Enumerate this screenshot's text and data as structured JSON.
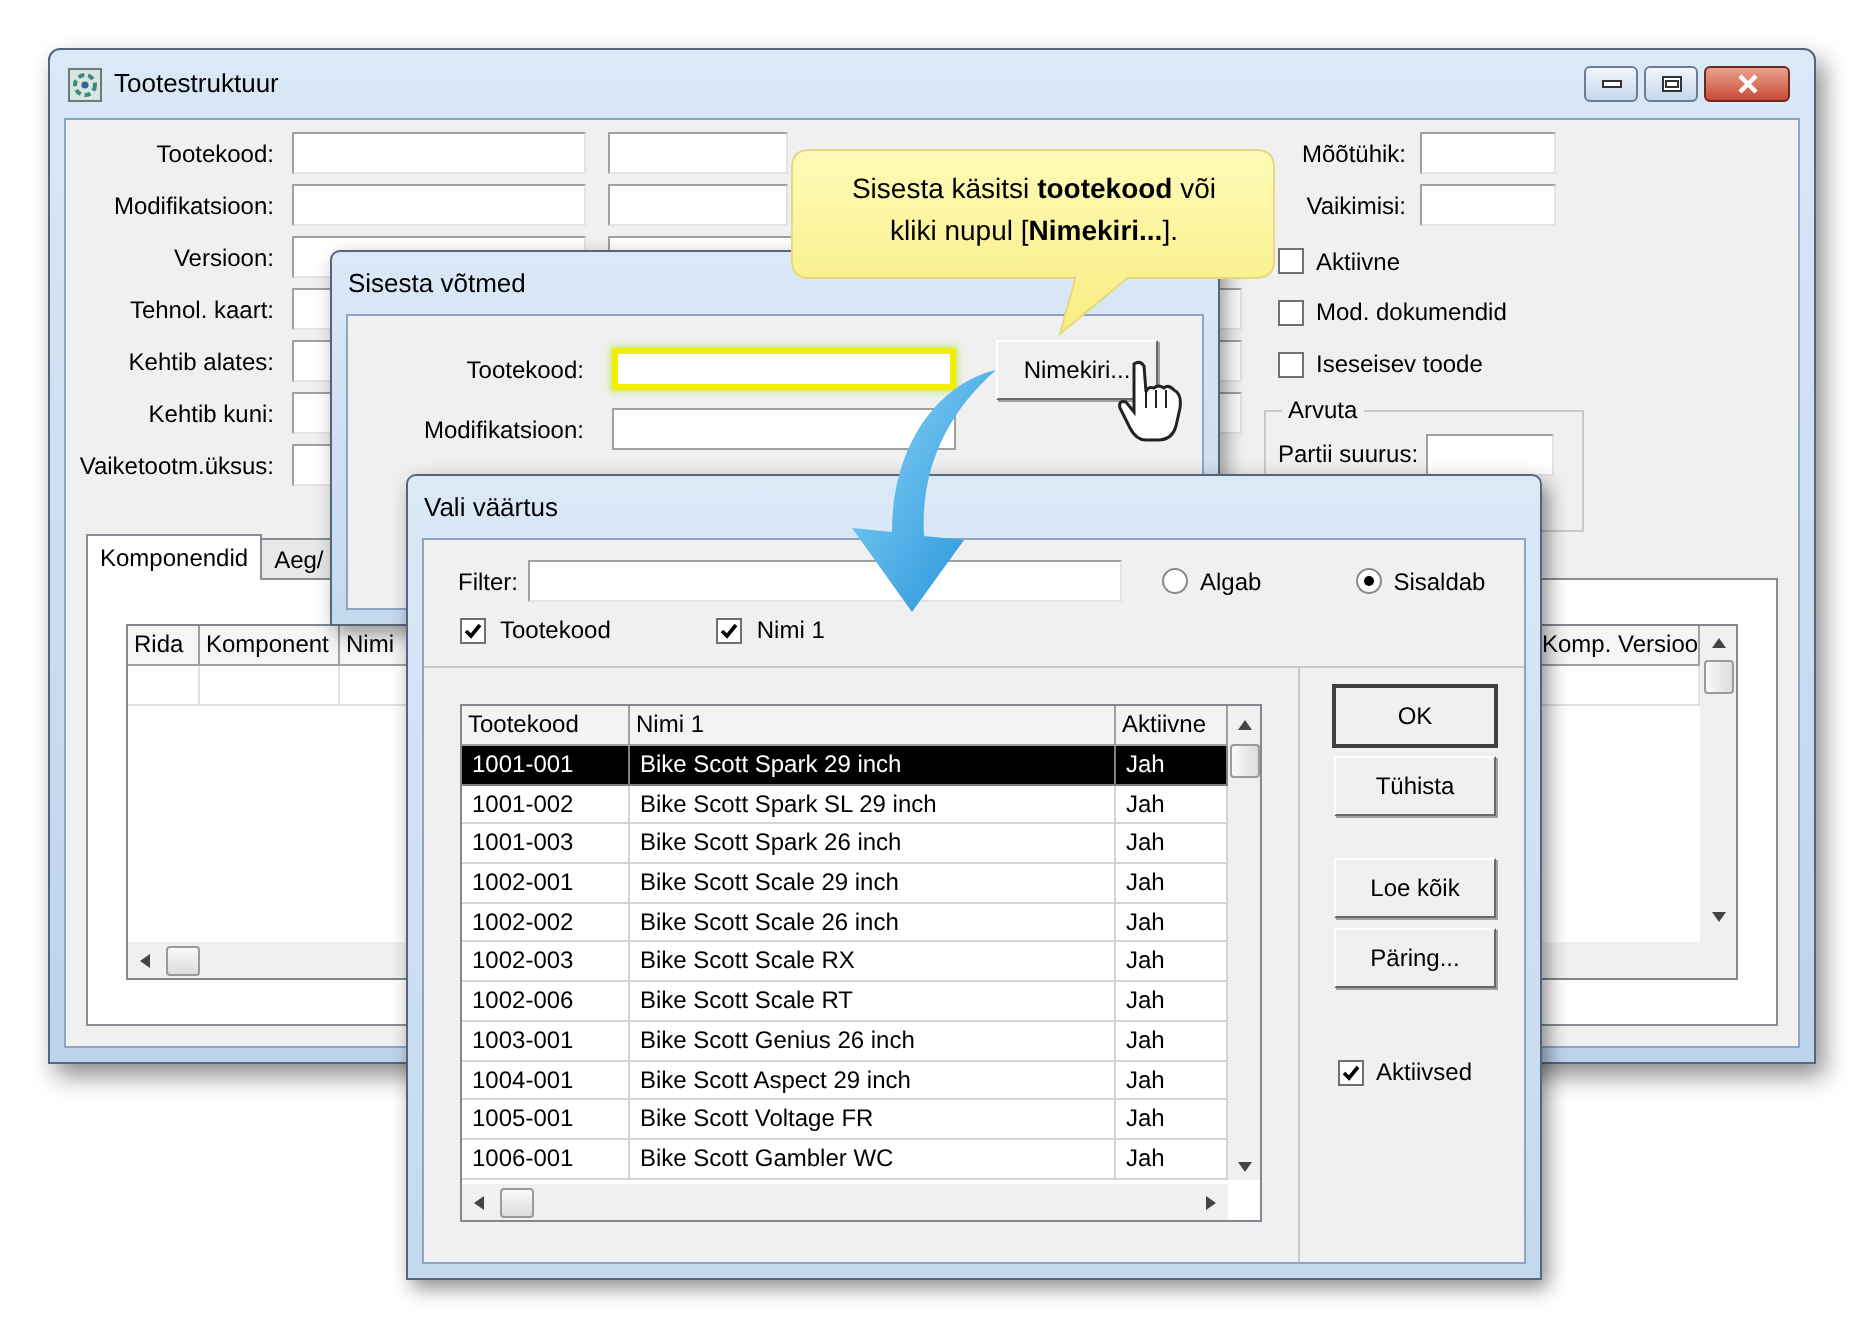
{
  "main_window": {
    "title": "Tootestruktuur",
    "fields": [
      "Tootekood:",
      "Modifikatsioon:",
      "Versioon:",
      "Tehnol. kaart:",
      "Kehtib alates:",
      "Kehtib kuni:",
      "Vaiketootm.üksus:"
    ],
    "side_fields": [
      "Mõõtühik:",
      "Vaikimisi:"
    ],
    "checkboxes": [
      {
        "label": "Aktiivne",
        "checked": false
      },
      {
        "label": "Mod. dokumendid",
        "checked": false
      },
      {
        "label": "Iseseisev toode",
        "checked": false
      }
    ],
    "group": {
      "title": "Arvuta",
      "field_label": "Partii suurus:"
    },
    "tabs": [
      {
        "label": "Komponendid",
        "selected": true
      },
      {
        "label": "Aeg/",
        "selected": false
      }
    ],
    "grid": {
      "columns": [
        "Rida",
        "Komponent",
        "Nimi",
        "Komp. Versioo"
      ]
    }
  },
  "keys_dialog": {
    "title": "Sisesta võtmed",
    "fields": [
      {
        "label": "Tootekood:",
        "focused": true
      },
      {
        "label": "Modifikatsioon:",
        "focused": false
      }
    ],
    "button": "Nimekiri..."
  },
  "callout": {
    "text": "Sisesta käsitsi **tootekood** või kliki nupul [**Nimekiri...**]."
  },
  "select_dialog": {
    "title": "Vali väärtus",
    "filter_label": "Filter:",
    "radios": [
      {
        "label": "Algab",
        "selected": false
      },
      {
        "label": "Sisaldab",
        "selected": true
      }
    ],
    "checkboxes": [
      {
        "label": "Tootekood",
        "checked": true
      },
      {
        "label": "Nimi 1",
        "checked": true
      }
    ],
    "table": {
      "columns": [
        "Tootekood",
        "Nimi 1",
        "Aktiivne"
      ],
      "rows": [
        {
          "cells": [
            "1001-001",
            "Bike Scott Spark 29 inch",
            "Jah"
          ],
          "selected": true
        },
        {
          "cells": [
            "1001-002",
            "Bike Scott Spark SL 29 inch",
            "Jah"
          ],
          "selected": false
        },
        {
          "cells": [
            "1001-003",
            "Bike Scott Spark 26 inch",
            "Jah"
          ],
          "selected": false
        },
        {
          "cells": [
            "1002-001",
            "Bike Scott Scale 29 inch",
            "Jah"
          ],
          "selected": false
        },
        {
          "cells": [
            "1002-002",
            "Bike Scott Scale 26 inch",
            "Jah"
          ],
          "selected": false
        },
        {
          "cells": [
            "1002-003",
            "Bike Scott Scale RX",
            "Jah"
          ],
          "selected": false
        },
        {
          "cells": [
            "1002-006",
            "Bike Scott Scale RT",
            "Jah"
          ],
          "selected": false
        },
        {
          "cells": [
            "1003-001",
            "Bike Scott Genius 26 inch",
            "Jah"
          ],
          "selected": false
        },
        {
          "cells": [
            "1004-001",
            "Bike Scott Aspect 29 inch",
            "Jah"
          ],
          "selected": false
        },
        {
          "cells": [
            "1005-001",
            "Bike Scott Voltage FR",
            "Jah"
          ],
          "selected": false
        },
        {
          "cells": [
            "1006-001",
            "Bike Scott Gambler WC",
            "Jah"
          ],
          "selected": false
        }
      ]
    },
    "buttons": [
      "OK",
      "Tühista",
      "Loe kõik",
      "Päring..."
    ],
    "active_checkbox": {
      "label": "Aktiivsed",
      "checked": true
    }
  }
}
